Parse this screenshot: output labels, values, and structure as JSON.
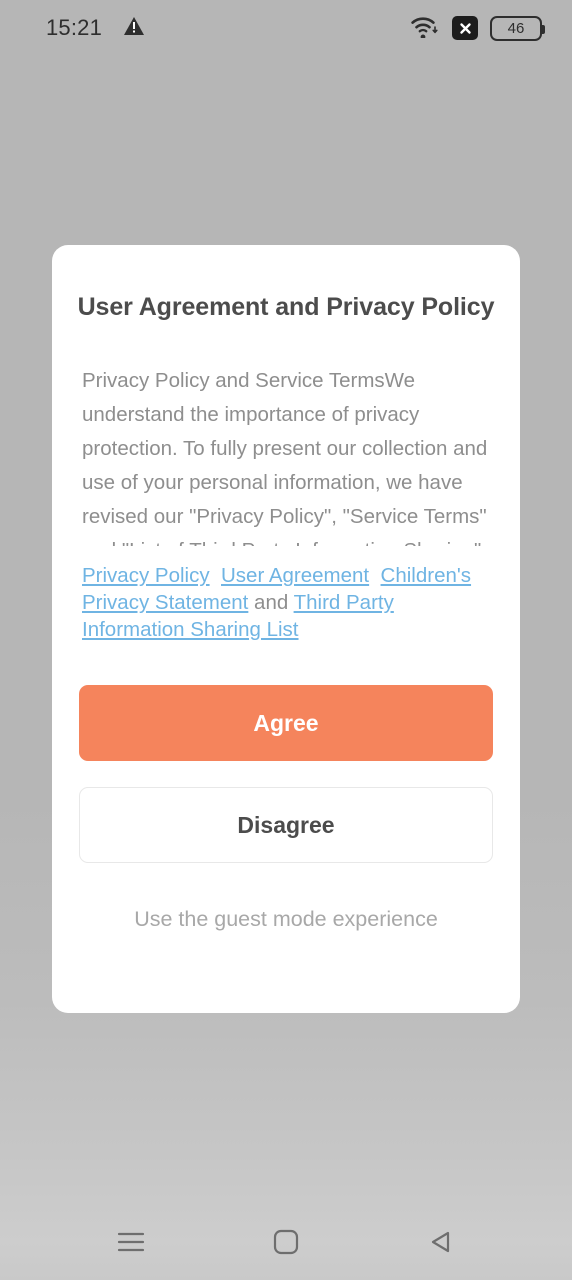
{
  "status_bar": {
    "time": "15:21",
    "warning_icon": "warning-triangle-icon",
    "wifi_icon": "wifi-icon",
    "x_badge_icon": "close-x-badge-icon",
    "battery_level": "46"
  },
  "dialog": {
    "title": "User Agreement and Privacy Policy",
    "body": "Privacy Policy and Service TermsWe understand the importance of privacy protection. To fully present our collection and use of your personal information, we have revised our \"Privacy Policy\", \"Service Terms\" and \"List of Third Party Information Sharing\" and other related agreements, please read carefully and fully understand the relevant terms.",
    "links": {
      "privacy_policy": "Privacy Policy",
      "user_agreement": "User Agreement",
      "childrens_privacy": "Children's Privacy Statement",
      "conjunction": "and",
      "third_party": "Third Party Information Sharing List"
    },
    "agree_label": "Agree",
    "disagree_label": "Disagree",
    "guest_mode_label": "Use the guest mode experience"
  },
  "nav_bar": {
    "recents_icon": "menu-hamburger-icon",
    "home_icon": "home-square-icon",
    "back_icon": "back-triangle-icon"
  },
  "colors": {
    "accent": "#f5845c",
    "link": "#6fb4e3",
    "title_text": "#4c4c4c",
    "body_text": "#8e8e8e",
    "muted_text": "#a8a8a8",
    "dialog_bg": "#ffffff",
    "screen_bg": "#b6b6b6"
  }
}
